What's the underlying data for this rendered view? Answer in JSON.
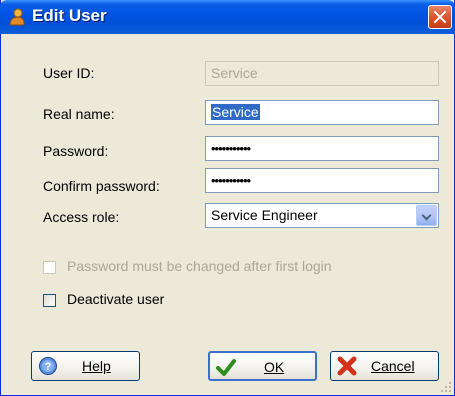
{
  "window": {
    "title": "Edit User"
  },
  "form": {
    "user_id_label": "User ID:",
    "user_id_value": "Service",
    "real_name_label": "Real name:",
    "real_name_value": "Service",
    "password_label": "Password:",
    "password_value": "•••••••••••",
    "confirm_password_label": "Confirm password:",
    "confirm_password_value": "•••••••••••",
    "access_role_label": "Access role:",
    "access_role_value": "Service Engineer"
  },
  "options": {
    "password_change_label": "Password must be changed after first login",
    "deactivate_label": "Deactivate user"
  },
  "buttons": {
    "help": "Help",
    "ok": "OK",
    "cancel": "Cancel"
  },
  "icons": {
    "title": "user-icon",
    "help": "help-icon",
    "ok": "checkmark-icon",
    "cancel": "cancel-icon"
  }
}
